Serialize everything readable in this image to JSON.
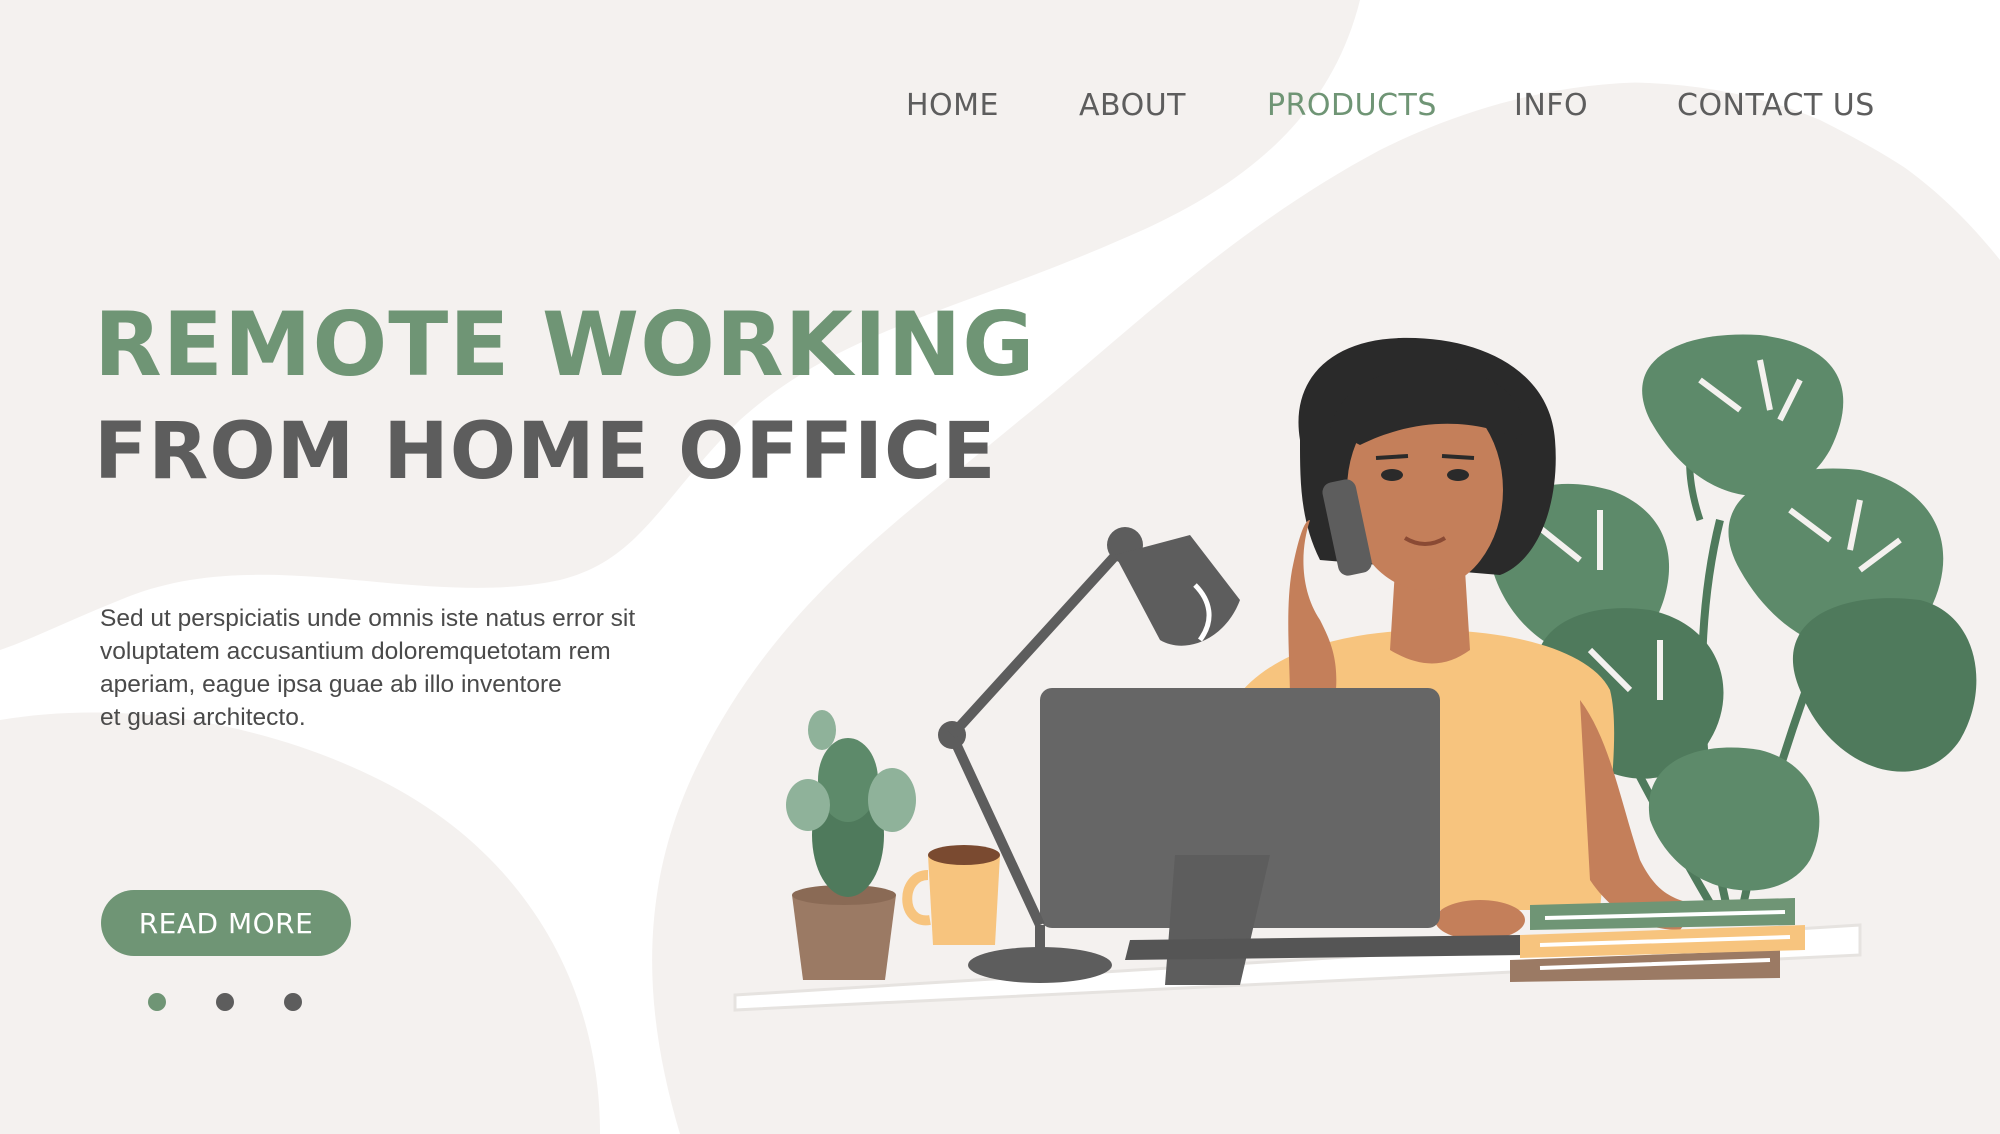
{
  "nav": {
    "items": [
      {
        "label": "HOME",
        "active": false
      },
      {
        "label": "ABOUT",
        "active": false
      },
      {
        "label": "PRODUCTS",
        "active": true
      },
      {
        "label": "INFO",
        "active": false
      },
      {
        "label": "CONTACT US",
        "active": false
      }
    ]
  },
  "hero": {
    "title": "REMOTE WORKING",
    "subtitle": "FROM HOME OFFICE",
    "body_lines": [
      "Sed ut perspiciatis unde omnis iste natus error sit",
      "voluptatem accusantium doloremquetotam rem",
      "aperiam, eague ipsa guae ab illo inventore",
      "et guasi architecto."
    ],
    "button_label": "READ MORE"
  },
  "carousel": {
    "total": 3,
    "active_index": 0
  },
  "colors": {
    "accent": "#6f9575",
    "text_dark": "#5d5d5d",
    "background_blob": "#f4f1ef",
    "background": "#ffffff"
  },
  "illustration": {
    "icons": [
      "woman-on-phone-illustration",
      "desk-lamp-icon",
      "monitor-icon",
      "keyboard-icon",
      "cactus-icon",
      "coffee-mug-icon",
      "books-icon",
      "monstera-plant-icon"
    ]
  }
}
